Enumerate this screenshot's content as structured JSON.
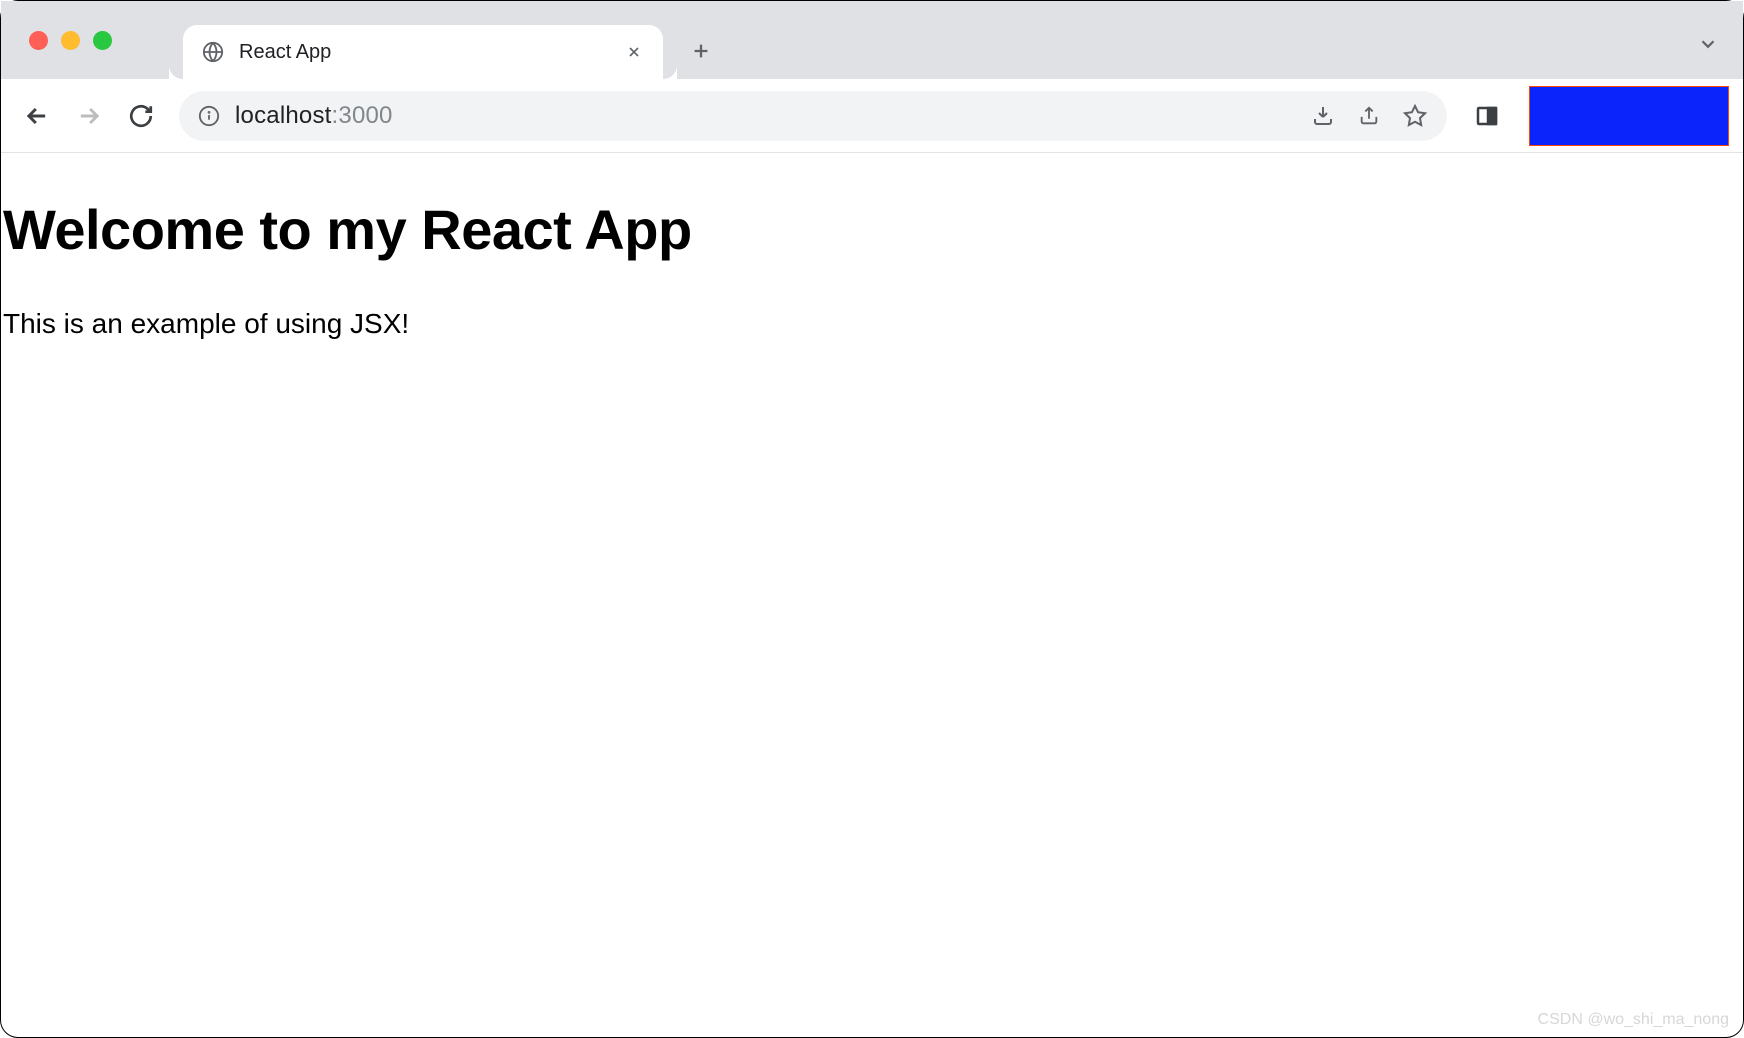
{
  "window": {
    "tab_title": "React App",
    "url_host": "localhost",
    "url_port": ":3000"
  },
  "page": {
    "heading": "Welcome to my React App",
    "paragraph": "This is an example of using JSX!"
  },
  "watermark": "CSDN @wo_shi_ma_nong",
  "colors": {
    "profile_box": "#0b24fb"
  }
}
